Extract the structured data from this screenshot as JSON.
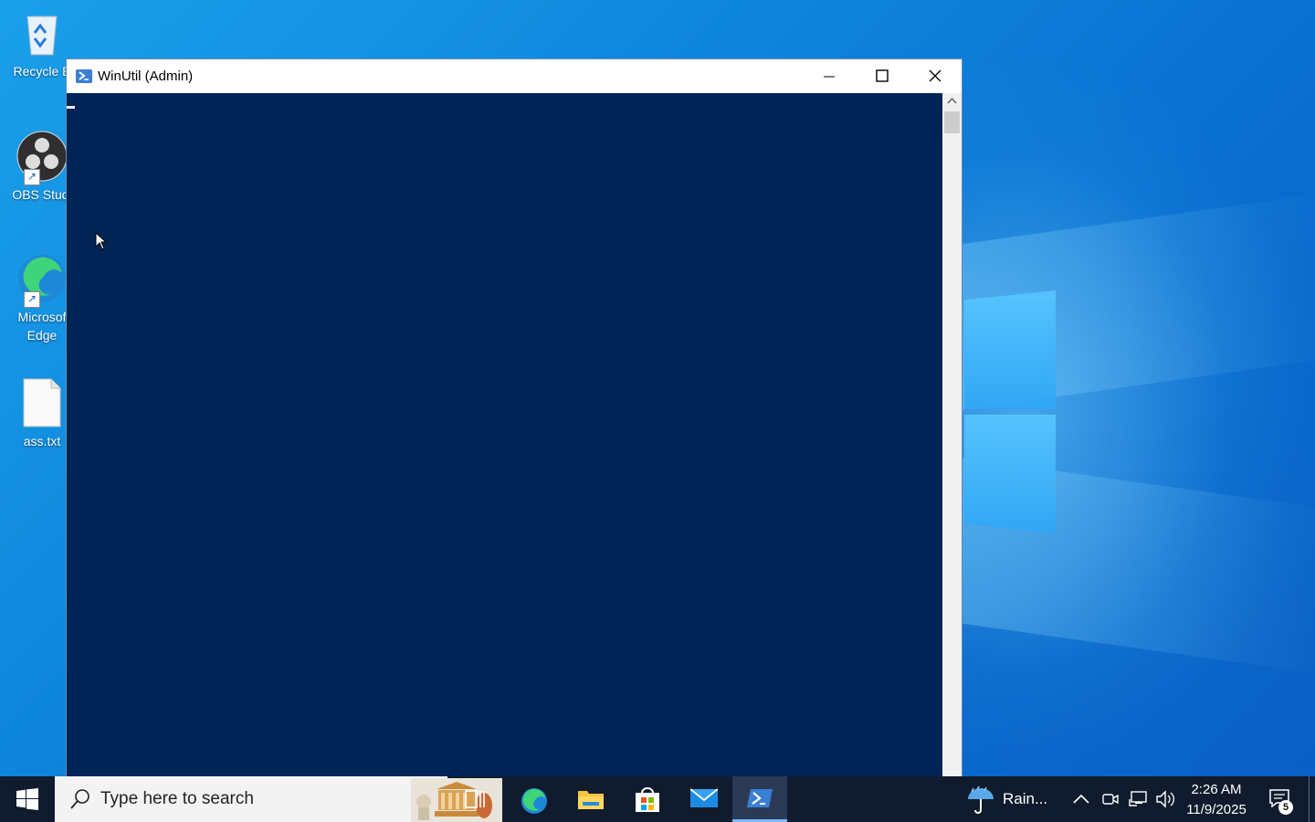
{
  "desktop": {
    "icons": [
      {
        "label": "Recycle Bin",
        "icon": "recycle-bin-icon"
      },
      {
        "label": "OBS Studio",
        "icon": "obs-studio-icon"
      },
      {
        "label": "Microsoft Edge",
        "icon": "edge-icon"
      },
      {
        "label": "ass.txt",
        "icon": "text-file-icon"
      }
    ],
    "icon_labels_visible": [
      "Recycle B",
      "OBS Studi",
      "Microsof\nEdge",
      "ass.txt"
    ]
  },
  "window": {
    "title": "WinUtil (Admin)",
    "icon": "powershell-icon",
    "controls": [
      "minimize",
      "maximize",
      "close"
    ],
    "console_bg": "#012456"
  },
  "taskbar": {
    "search_placeholder": "Type here to search",
    "pinned_apps": [
      "task-view",
      "edge",
      "file-explorer",
      "microsoft-store",
      "mail",
      "powershell"
    ],
    "active_app": "powershell",
    "weather": "Rain...",
    "time": "2:26 AM",
    "date": "11/9/2025",
    "notification_count": "5"
  },
  "colors": {
    "desktop_accent": "#0f86dd",
    "taskbar": "#101c2e",
    "console": "#012456"
  }
}
